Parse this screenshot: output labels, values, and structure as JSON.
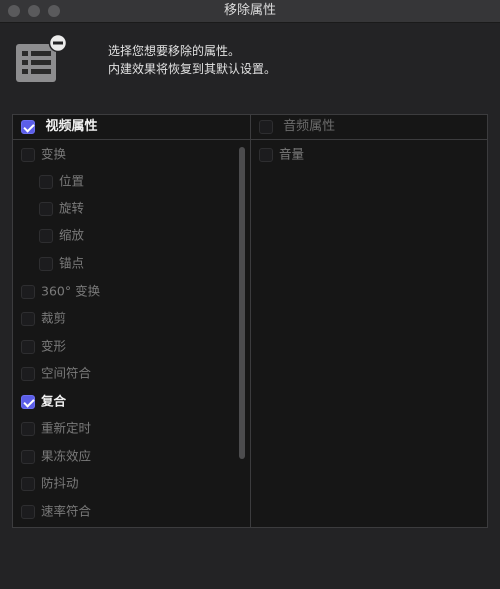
{
  "window": {
    "title": "移除属性"
  },
  "message": {
    "line1": "选择您想要移除的属性。",
    "line2": "内建效果将恢复到其默认设置。"
  },
  "video": {
    "header": {
      "label": "视频属性",
      "checked": true
    },
    "items": [
      {
        "label": "变换",
        "checked": false,
        "indent": 0
      },
      {
        "label": "位置",
        "checked": false,
        "indent": 1
      },
      {
        "label": "旋转",
        "checked": false,
        "indent": 1
      },
      {
        "label": "缩放",
        "checked": false,
        "indent": 1
      },
      {
        "label": "锚点",
        "checked": false,
        "indent": 1
      },
      {
        "label": "360° 变换",
        "checked": false,
        "indent": 0
      },
      {
        "label": "裁剪",
        "checked": false,
        "indent": 0
      },
      {
        "label": "变形",
        "checked": false,
        "indent": 0
      },
      {
        "label": "空间符合",
        "checked": false,
        "indent": 0
      },
      {
        "label": "复合",
        "checked": true,
        "indent": 0
      },
      {
        "label": "重新定时",
        "checked": false,
        "indent": 0
      },
      {
        "label": "果冻效应",
        "checked": false,
        "indent": 0
      },
      {
        "label": "防抖动",
        "checked": false,
        "indent": 0
      },
      {
        "label": "速率符合",
        "checked": false,
        "indent": 0
      }
    ]
  },
  "audio": {
    "header": {
      "label": "音频属性",
      "checked": false
    },
    "items": [
      {
        "label": "音量",
        "checked": false,
        "indent": 0
      }
    ]
  },
  "colors": {
    "accent": "#5b5ee8",
    "panel": "#161616",
    "window": "#232325"
  }
}
